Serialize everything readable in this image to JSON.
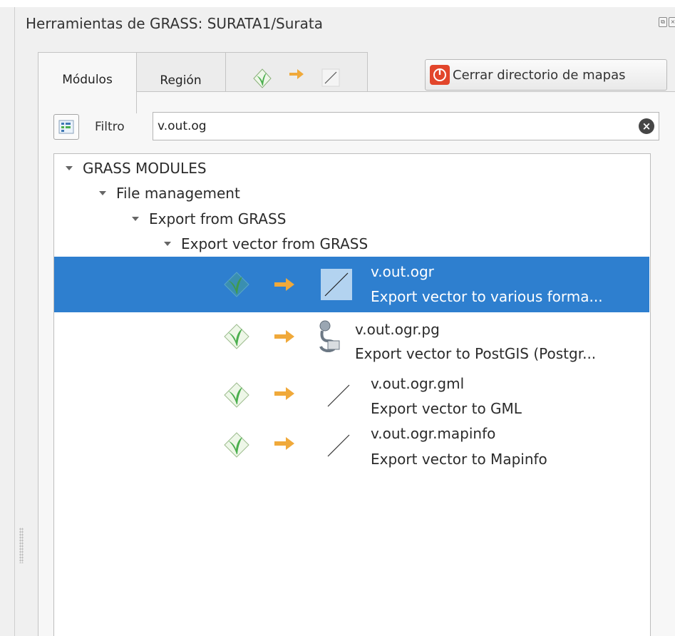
{
  "window": {
    "title": "Herramientas de GRASS: SURATA1/Surata",
    "float_icon": "float-icon",
    "close_icon": "close-window-icon"
  },
  "tabs": [
    {
      "label": "Módulos",
      "active": true
    },
    {
      "label": "Región",
      "active": false
    },
    {
      "label": "",
      "icons": [
        "grass-icon",
        "arrow-icon",
        "vector-line-icon"
      ],
      "active": false
    }
  ],
  "close_mapset_button": {
    "label": "Cerrar directorio de mapas",
    "icon": "power-icon"
  },
  "filter": {
    "label": "Filtro",
    "value": "v.out.og",
    "icon": "tree-view-icon",
    "clear_icon": "clear-icon"
  },
  "tree": {
    "groups": [
      "GRASS MODULES",
      "File management",
      "Export from GRASS",
      "Export vector from GRASS"
    ],
    "modules": [
      {
        "name": "v.out.ogr",
        "description": "Export vector to various forma...",
        "type_icon": "vector-line-icon",
        "selected": true
      },
      {
        "name": "v.out.ogr.pg",
        "description": "Export vector to PostGIS (Postgr...",
        "type_icon": "postgis-icon",
        "selected": false
      },
      {
        "name": "v.out.ogr.gml",
        "description": "Export vector to GML",
        "type_icon": "vector-line-icon",
        "selected": false
      },
      {
        "name": "v.out.ogr.mapinfo",
        "description": "Export vector to Mapinfo",
        "type_icon": "vector-line-icon",
        "selected": false
      }
    ]
  },
  "colors": {
    "selection": "#2e7fcf",
    "arrow": "#f0a93a",
    "grass_green": "#4caf4f",
    "close_button_red": "#e2462b"
  }
}
